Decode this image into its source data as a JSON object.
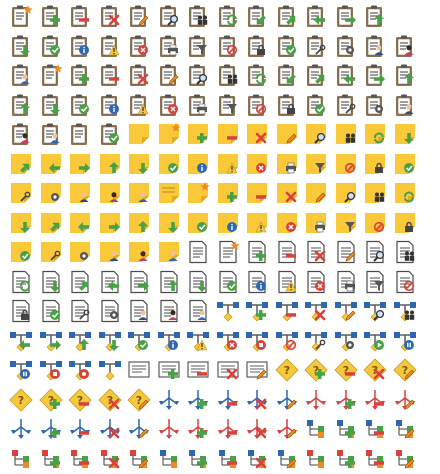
{
  "colors": {
    "clipboard": "#8a7356",
    "board_paper": "#ffffff",
    "board_lines": "#3b3b3b",
    "note": "#f9c93a",
    "note_fold": "#e7a81a",
    "doc": "#4b4b4b",
    "green": "#49a046",
    "red": "#d9413c",
    "blue": "#2e67b1",
    "yellow": "#f5c842",
    "orange": "#f08a24",
    "gray": "#5c5c5c"
  },
  "rows": [
    [
      "clipboard-star-icon",
      "clipboard-add-icon",
      "clipboard-remove-icon",
      "clipboard-delete-icon",
      "clipboard-edit-icon",
      "clipboard-find-icon",
      "clipboard-users-icon",
      "clipboard-refresh-icon",
      "clipboard-arrow-down-left-icon",
      "clipboard-arrow-up-right-icon",
      "clipboard-arrow-left-icon",
      "clipboard-arrow-right-icon",
      "clipboard-arrow-up-icon"
    ],
    [
      "clipboard-arrow-down-icon",
      "clipboard-check-icon",
      "clipboard-info-icon",
      "clipboard-warning-icon",
      "clipboard-error-icon",
      "clipboard-print-icon",
      "clipboard-filter-icon",
      "clipboard-forbidden-icon",
      "clipboard-lock-icon",
      "clipboard-checklist-icon",
      "clipboard-tools-icon",
      "clipboard-settings-icon",
      "clipboard-user-icon",
      "clipboard-user-alt-icon"
    ],
    [
      "clipboard-user-blue-icon",
      "clipboard-star-icon",
      "clipboard-add-icon",
      "clipboard-remove-icon",
      "clipboard-delete-icon",
      "clipboard-edit-icon",
      "clipboard-find-icon",
      "clipboard-users-icon",
      "clipboard-refresh-icon",
      "clipboard-arrow-down-left-icon",
      "clipboard-arrow-up-right-icon",
      "clipboard-arrow-left-icon",
      "clipboard-arrow-right-icon",
      "clipboard-arrow-up-icon"
    ],
    [
      "clipboard-arrow-up-icon",
      "clipboard-arrow-down-icon",
      "clipboard-check-icon",
      "clipboard-info-icon",
      "clipboard-warning-icon",
      "clipboard-error-icon",
      "clipboard-print-icon",
      "clipboard-filter-icon",
      "clipboard-forbidden-icon",
      "clipboard-lock-icon",
      "clipboard-checklist-icon",
      "clipboard-tools-icon",
      "clipboard-settings-icon",
      "clipboard-user-icon"
    ],
    [
      "clipboard-user-alt-icon",
      "clipboard-user-blue-icon",
      "clipboard-blank-icon",
      "clipboard-checkbox-icon",
      "note-icon",
      "note-star-icon",
      "note-add-icon",
      "note-remove-icon",
      "note-delete-icon",
      "note-edit-icon",
      "note-find-icon",
      "note-users-icon",
      "note-refresh-icon",
      "note-arrow-down-icon"
    ],
    [
      "note-arrow-up-right-icon",
      "note-arrow-left-icon",
      "note-arrow-right-icon",
      "note-arrow-up-icon",
      "note-arrow-down-icon",
      "note-check-icon",
      "note-info-icon",
      "note-warning-icon",
      "note-error-icon",
      "note-print-icon",
      "note-filter-icon",
      "note-forbidden-icon",
      "note-lock-icon",
      "note-checklist-icon"
    ],
    [
      "note-tools-icon",
      "note-settings-icon",
      "note-user-icon",
      "note-user-alt-icon",
      "note-user-blue-icon",
      "note-lines-icon",
      "note-star-icon",
      "note-add-icon",
      "note-remove-icon",
      "note-delete-icon",
      "note-edit-icon",
      "note-find-icon",
      "note-users-icon",
      "note-refresh-icon"
    ],
    [
      "note-arrow-down-icon",
      "note-arrow-up-right-icon",
      "note-arrow-left-icon",
      "note-arrow-right-icon",
      "note-arrow-up-icon",
      "note-arrow-down-icon",
      "note-check-icon",
      "note-info-icon",
      "note-warning-icon",
      "note-error-icon",
      "note-print-icon",
      "note-filter-icon",
      "note-forbidden-icon",
      "note-lock-icon"
    ],
    [
      "note-checklist-icon",
      "note-tools-icon",
      "note-settings-icon",
      "note-user-icon",
      "note-user-alt-icon",
      "note-user-blue-icon",
      "document-icon",
      "document-star-icon",
      "document-add-icon",
      "document-remove-icon",
      "document-delete-icon",
      "document-edit-icon",
      "document-find-icon",
      "document-users-icon"
    ],
    [
      "document-refresh-icon",
      "document-arrow-down-icon",
      "document-arrow-up-right-icon",
      "document-arrow-left-icon",
      "document-arrow-right-icon",
      "document-arrow-up-icon",
      "document-arrow-down-icon",
      "document-check-icon",
      "document-info-icon",
      "document-warning-icon",
      "document-error-icon",
      "document-print-icon",
      "document-filter-icon",
      "document-forbidden-icon"
    ],
    [
      "document-lock-icon",
      "document-checklist-icon",
      "document-tools-icon",
      "document-settings-icon",
      "document-user-icon",
      "document-user-alt-icon",
      "document-user-blue-icon",
      "flow-icon",
      "flow-add-icon",
      "flow-remove-icon",
      "flow-delete-icon",
      "flow-edit-icon",
      "flow-find-icon",
      "flow-users-icon"
    ],
    [
      "flow-arrow-left-icon",
      "flow-arrow-right-icon",
      "flow-arrow-up-icon",
      "flow-arrow-down-icon",
      "flow-check-icon",
      "flow-info-icon",
      "flow-warning-icon",
      "flow-error-icon",
      "flow-stop-icon",
      "flow-forbidden-icon",
      "flow-tools-icon",
      "flow-settings-icon",
      "flow-play-icon",
      "flow-pause-icon"
    ],
    [
      "flow-pause-icon",
      "flow-stop-icon",
      "flow-record-icon",
      "flow-blank-icon",
      "list-icon",
      "list-add-icon",
      "list-remove-icon",
      "list-delete-icon",
      "list-edit-icon",
      "diamond-question-icon",
      "diamond-add-icon",
      "diamond-remove-icon",
      "diamond-delete-icon",
      "diamond-edit-icon"
    ],
    [
      "diamond-question-icon",
      "diamond-add-icon",
      "diamond-remove-icon",
      "diamond-delete-icon",
      "diamond-edit-icon",
      "branch-blue-icon",
      "branch-blue-add-icon",
      "branch-blue-remove-icon",
      "branch-blue-delete-icon",
      "branch-blue-edit-icon",
      "branch-red-icon",
      "branch-red-add-icon",
      "branch-red-remove-icon",
      "branch-red-edit-icon"
    ],
    [
      "branch-blue-icon",
      "branch-blue-add-icon",
      "branch-blue-remove-icon",
      "branch-blue-delete-icon",
      "branch-blue-edit-icon",
      "branch-red-icon",
      "branch-red-add-icon",
      "branch-red-remove-icon",
      "branch-red-delete-icon",
      "branch-red-edit-icon",
      "tree-blue-icon",
      "tree-blue-add-icon",
      "tree-blue-remove-icon",
      "tree-blue-edit-icon"
    ],
    [
      "tree-red-icon",
      "tree-red-add-icon",
      "tree-red-remove-icon",
      "tree-red-delete-icon",
      "tree-red-edit-icon",
      "tree-blue-icon",
      "tree-blue-add-icon",
      "tree-blue-remove-icon",
      "tree-blue-delete-icon",
      "tree-blue-edit-icon",
      "tree-red-icon",
      "tree-red-add-icon",
      "tree-red-remove-icon",
      "tree-red-edit-icon"
    ]
  ]
}
